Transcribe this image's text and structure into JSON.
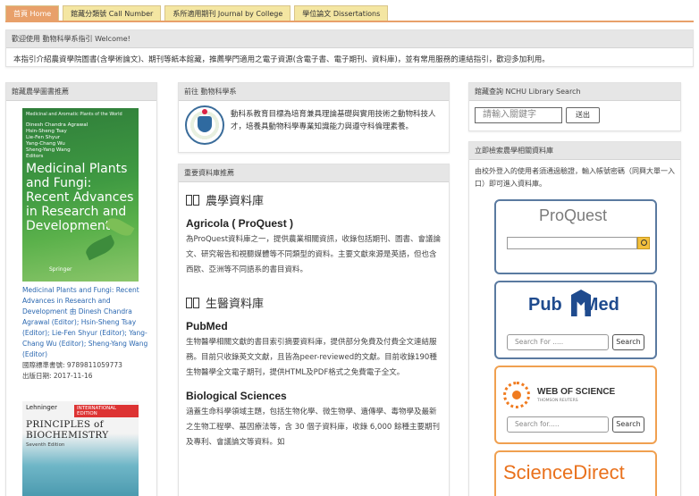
{
  "tabs": [
    {
      "label": "首頁 Home",
      "active": true
    },
    {
      "label": "館藏分類號 Call Number",
      "active": false
    },
    {
      "label": "系所適用期刊 Journal by College",
      "active": false
    },
    {
      "label": "學位論文 Dissertations",
      "active": false
    }
  ],
  "welcome": {
    "heading": "歡迎使用 動物科學系指引 Welcome!",
    "text": "本指引介紹農資學院圖書(含學術論文)、期刊等紙本館藏，推薦學門適用之電子資源(含電子書、電子期刊、資料庫)，並有常用服務的連結指引，歡迎多加利用。"
  },
  "new_books": {
    "heading": "館藏農學圖書推薦",
    "book1": {
      "series": "Medicinal and Aromatic Plants of the World",
      "authors": [
        "Dinesh Chandra Agrawal",
        "Hsin-Sheng Tsay",
        "Lie-Fen Shyur",
        "Yang-Chang Wu",
        "Sheng-Yang Wang",
        "Editors"
      ],
      "cover_title": "Medicinal Plants and Fungi: Recent Advances in Research and Development",
      "publisher": "Springer",
      "link_text": "Medicinal Plants and Fungi: Recent Advances in Research and Development 由 Dinesh Chandra Agrawal (Editor); Hsin-Sheng Tsay (Editor); Lie-Fen Shyur (Editor); Yang-Chang Wu (Editor); Sheng-Yang Wang (Editor)",
      "isbn": "國際標準書號: 9789811059773",
      "date": "出版日期: 2017-11-16"
    },
    "book2": {
      "author": "Lehninger",
      "edition": "INTERNATIONAL EDITION",
      "cover_title": "PRINCIPLES of BIOCHEMISTRY",
      "subtitle": "Seventh Edition"
    }
  },
  "dept": {
    "heading": "前往 動物科學系",
    "text": "動科系教育目標為培育兼具理論基礎與實用技術之動物科技人才，培養具動物科學專業知識能力與遵守科倫理素養。"
  },
  "resources": {
    "heading": "重要資料庫推薦",
    "cat1": "農學資料庫",
    "agricola_title": "Agricola ( ProQuest )",
    "agricola_desc": "為ProQuest資料庫之一，提供農業相關資訊，收錄包括期刊、圖書、會議論文、研究報告和視聽媒體等不同類型的資料。主要文獻來源是英語，但也含西歐、亞洲等不同語系的書目資料。",
    "cat2": "生醫資料庫",
    "pubmed_title": "PubMed",
    "pubmed_desc": "生物醫學相關文獻的書目索引摘要資料庫，提供部分免費及付費全文連結服務。目前只收錄英文文獻，且皆為peer-reviewed的文獻。目前收錄190種生物醫學全文電子期刊，提供HTML及PDF格式之免費電子全文。",
    "bio_title": "Biological Sciences",
    "bio_desc": "涵蓋生命科學領域主題，包括生物化學、微生物學、遺傳學、毒物學及最新之生物工程學、基因療法等，含 30 個子資料庫，收錄 6,000 餘種主要期刊及專利、會議論文等資料。如"
  },
  "search": {
    "heading": "館藏查詢 NCHU Library Search",
    "placeholder": "請輸入關鍵字",
    "button": "送出"
  },
  "offcampus": {
    "heading": "立即檢索農學相關資料庫",
    "intro": "由校外登入的使用者須通過驗證，輸入帳號密碼（同興大單一入口）即可進入資料庫。",
    "proquest_logo": "ProQuest",
    "pubmed_logo_a": "Pub",
    "pubmed_logo_b": "Med",
    "pubmed_placeholder": "Search For .....",
    "pubmed_button": "Search",
    "wos_logo": "WEB OF SCIENCE",
    "wos_sub": "THOMSON REUTERS",
    "wos_placeholder": "Search for.....",
    "wos_button": "Search",
    "sd_logo": "ScienceDirect"
  },
  "colors": {
    "tab_active": "#e8a06a",
    "tab_inactive": "#f4e6a2",
    "link": "#2a67b0",
    "card_blue": "#5a7aa0",
    "card_orange": "#f0a050"
  }
}
